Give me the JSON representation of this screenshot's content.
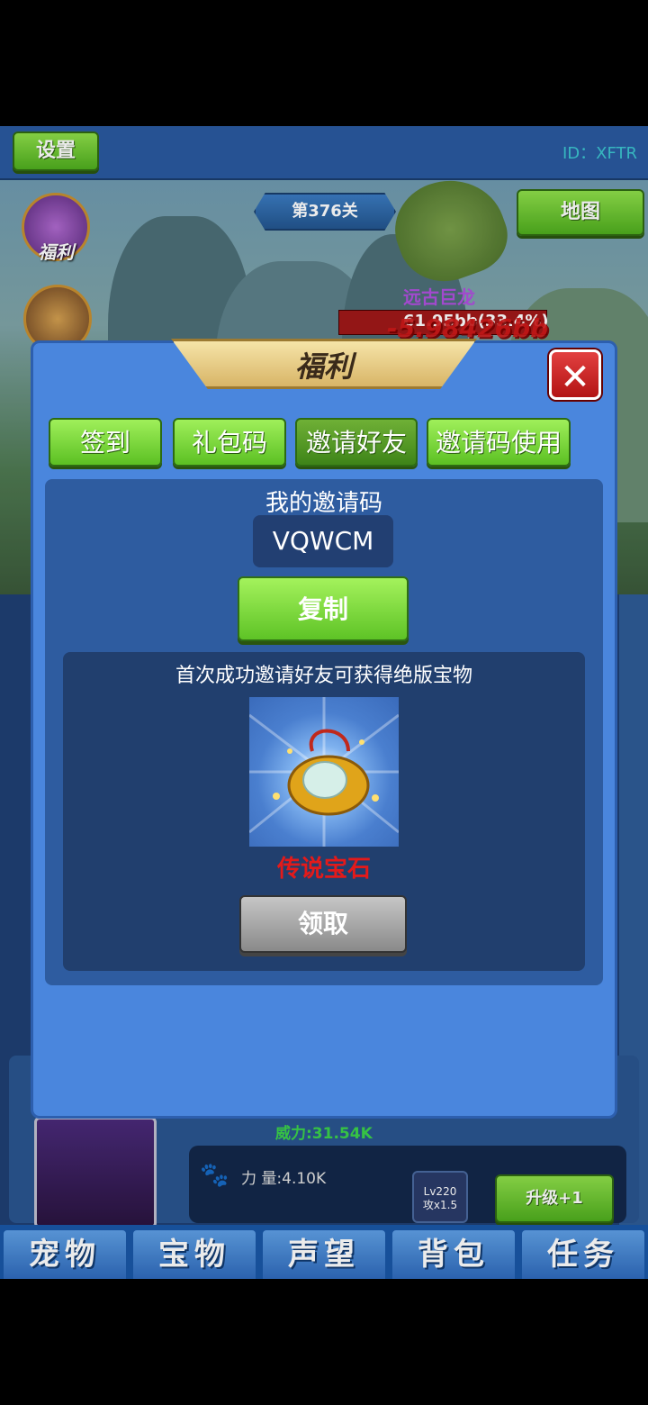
{
  "header": {
    "settings_label": "设置",
    "player_id": "ID：XFTR"
  },
  "scene": {
    "level_label": "第376关",
    "map_label": "地图",
    "welfare_icon_label": "福利",
    "boss_name": "远古巨龙",
    "boss_hp_text": "61.95bb(33.4%)",
    "damage_text": "-5.98426bb"
  },
  "pet": {
    "power_text": "威力:31.54K",
    "strength_text": "力 量:4.10K",
    "weapon_level": "Lv220",
    "weapon_mult": "攻x1.5",
    "upgrade_label": "升级+1"
  },
  "bottom_nav": {
    "tabs": [
      "宠物",
      "宝物",
      "声望",
      "背包",
      "任务"
    ]
  },
  "modal": {
    "title": "福利",
    "close_icon": "close-x-icon",
    "tabs": [
      "签到",
      "礼包码",
      "邀请好友",
      "邀请码使用"
    ],
    "active_tab": "邀请好友",
    "invite_heading": "我的邀请码",
    "invite_code": "VQWCM",
    "copy_label": "复制",
    "reward_desc": "首次成功邀请好友可获得绝版宝物",
    "reward_name": "传说宝石",
    "claim_label": "领取"
  },
  "colors": {
    "modal_bg": "#4a86dd",
    "green_button": "#5cc023",
    "reward_name_color": "#e41a1a",
    "claim_button": "#a0a0a0"
  }
}
